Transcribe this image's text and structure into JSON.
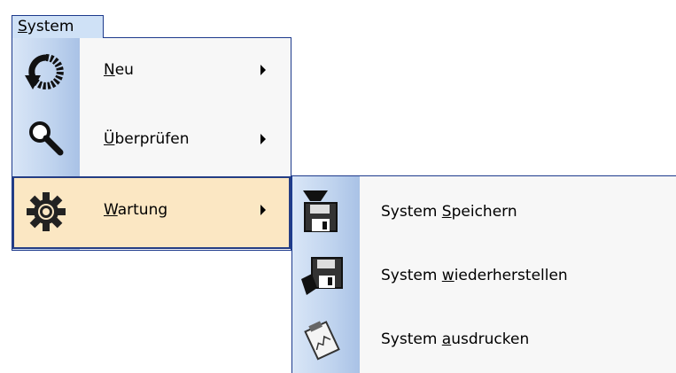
{
  "menubar": {
    "system_label_accel": "S",
    "system_label_rest": "ystem"
  },
  "menu": {
    "items": [
      {
        "accel": "N",
        "rest": "eu",
        "icon": "refresh-icon",
        "has_submenu": true
      },
      {
        "accel": "Ü",
        "rest": "berprüfen",
        "icon": "search-icon",
        "has_submenu": true
      },
      {
        "accel": "W",
        "rest": "artung",
        "icon": "gear-icon",
        "has_submenu": true,
        "selected": true
      }
    ]
  },
  "submenu": {
    "items": [
      {
        "prefix": "System ",
        "accel": "S",
        "rest": "peichern",
        "icon": "save-icon"
      },
      {
        "prefix": "System ",
        "accel": "w",
        "rest": "iederherstellen",
        "icon": "restore-icon"
      },
      {
        "prefix": "System ",
        "accel": "a",
        "rest": "usdrucken",
        "icon": "print-report-icon"
      }
    ]
  },
  "colors": {
    "border": "#1d3a8c",
    "selected_bg": "#fbe7c3",
    "menubar_bg": "#cfe1f6",
    "menu_bg": "#f7f7f7"
  }
}
